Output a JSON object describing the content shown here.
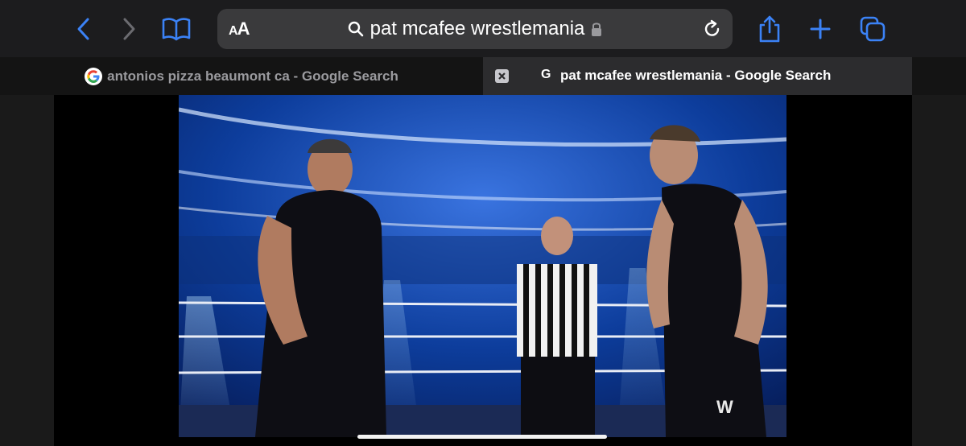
{
  "toolbar": {
    "back_icon": "chevron-left-icon",
    "forward_icon": "chevron-right-icon",
    "bookmarks_icon": "book-icon",
    "reader_label_small": "A",
    "reader_label_large": "A",
    "search_icon": "magnifier-icon",
    "address_text": "pat mcafee wrestlemania",
    "lock_icon": "lock-icon",
    "reload_icon": "reload-icon",
    "share_icon": "share-icon",
    "new_tab_icon": "plus-icon",
    "tabs_icon": "tabs-icon",
    "accent_color": "#3b82f6"
  },
  "tabs": [
    {
      "title": "antonios pizza beaumont ca - Google Search",
      "favicon": "google-g-icon",
      "active": false
    },
    {
      "title": "pat mcafee wrestlemania - Google Search",
      "favicon_letter": "G",
      "active": true
    }
  ],
  "content": {
    "image_description": "",
    "watermark_logo": "WWE"
  }
}
